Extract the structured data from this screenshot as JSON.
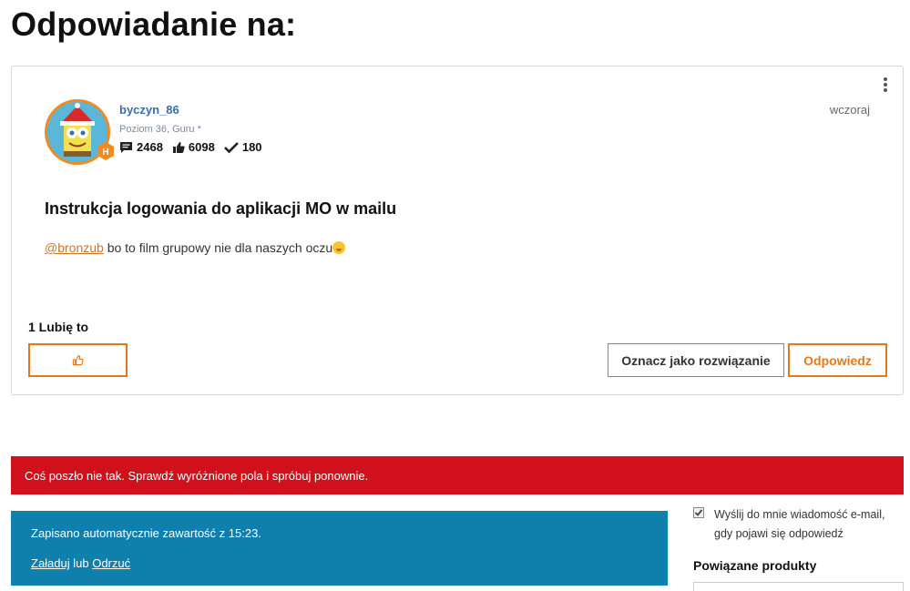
{
  "page": {
    "title": "Odpowiadanie na:"
  },
  "post": {
    "author": {
      "username": "byczyn_86",
      "rank": "Poziom 36, Guru *",
      "badge_letter": "H",
      "stats": {
        "posts": "2468",
        "likes": "6098",
        "solutions": "180"
      }
    },
    "timestamp": "wczoraj",
    "subject": "Instrukcja logowania do aplikacji MO w mailu",
    "body": {
      "mention": "@bronzub",
      "text": " bo to film grupowy nie dla naszych oczu",
      "emoji": "tongue-out-emoji"
    },
    "likes_label": "1 Lubię to",
    "mark_solution_label": "Oznacz jako rozwiązanie",
    "reply_label": "Odpowiedz"
  },
  "error_banner": {
    "text": "Coś poszło nie tak. Sprawdź wyróżnione pola i spróbuj ponownie."
  },
  "autosave": {
    "message": "Zapisano automatycznie zawartość z 15:23.",
    "load_label": "Załaduj",
    "or_text": " lub ",
    "discard_label": "Odrzuć"
  },
  "notify": {
    "checked": true,
    "label": "Wyślij do mnie wiadomość e-mail, gdy pojawi się odpowiedź"
  },
  "related": {
    "heading": "Powiązane produkty"
  },
  "colors": {
    "accent": "#e07a1f",
    "error": "#d0101a",
    "info": "#0f7fae",
    "link": "#3a6ea5"
  }
}
